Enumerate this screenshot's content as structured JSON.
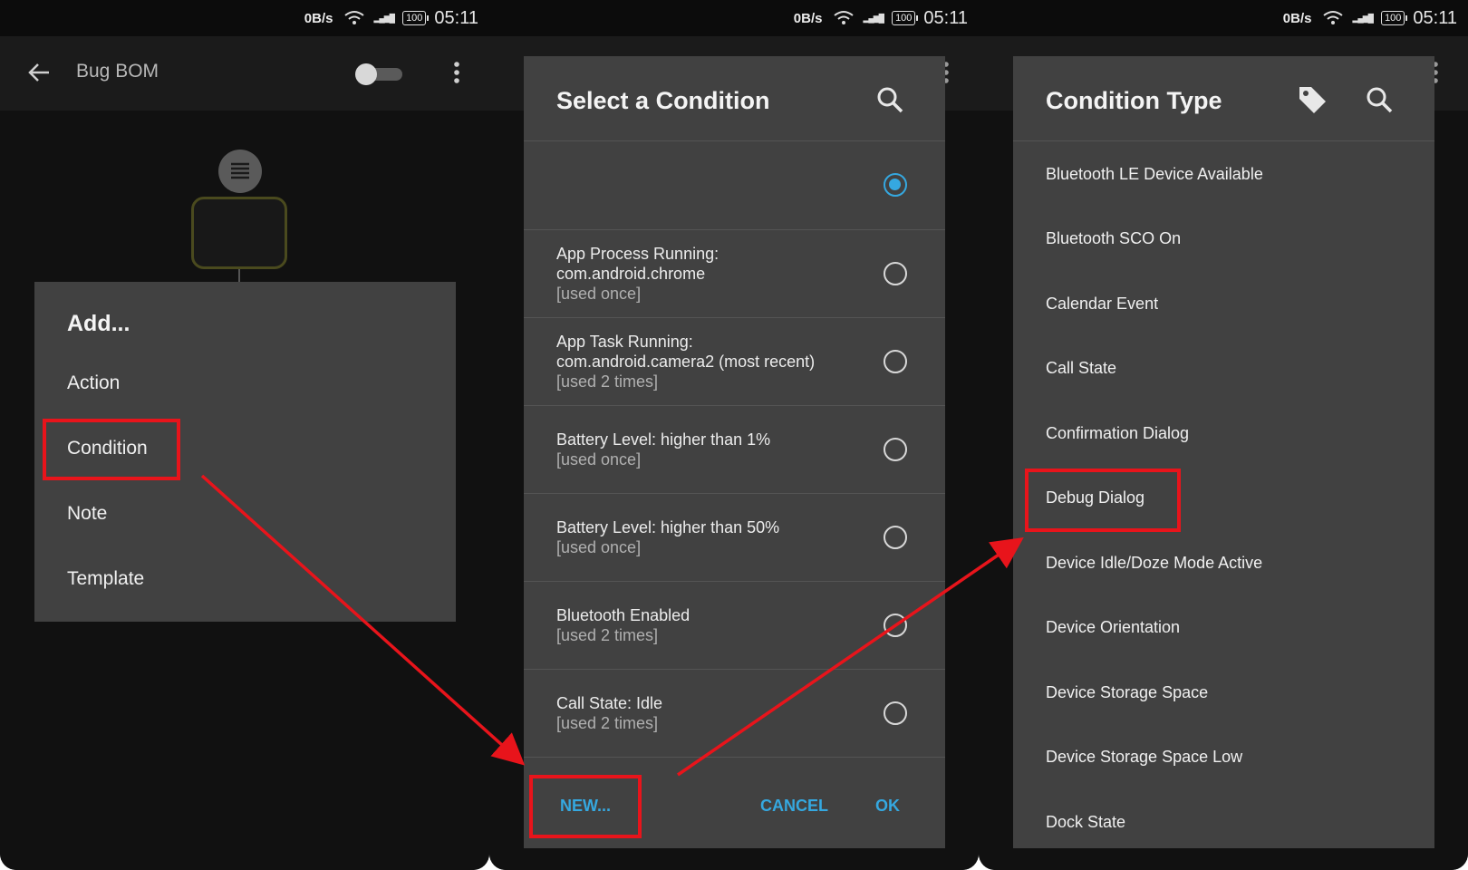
{
  "status_bar": {
    "speed": "0B/s",
    "signal": "4G 2G",
    "battery": "100",
    "time": "05:11"
  },
  "screen1": {
    "app_title": "Bug BOM",
    "add_menu": {
      "title": "Add...",
      "items": [
        "Action",
        "Condition",
        "Note",
        "Template"
      ]
    }
  },
  "screen2": {
    "dialog_title": "Select a Condition",
    "conditions": [
      {
        "title": "",
        "sub": "",
        "selected": true
      },
      {
        "title": "App Process Running:\ncom.android.chrome",
        "sub": "[used once]",
        "selected": false
      },
      {
        "title": "App Task Running:\ncom.android.camera2 (most recent)",
        "sub": "[used 2 times]",
        "selected": false
      },
      {
        "title": "Battery Level: higher than 1%",
        "sub": "[used once]",
        "selected": false
      },
      {
        "title": "Battery Level: higher than 50%",
        "sub": "[used once]",
        "selected": false
      },
      {
        "title": "Bluetooth Enabled",
        "sub": "[used 2 times]",
        "selected": false
      },
      {
        "title": "Call State: Idle",
        "sub": "[used 2 times]",
        "selected": false
      }
    ],
    "buttons": {
      "new": "NEW...",
      "cancel": "CANCEL",
      "ok": "OK"
    }
  },
  "screen3": {
    "dialog_title": "Condition Type",
    "types": [
      "Bluetooth LE Device Available",
      "Bluetooth SCO On",
      "Calendar Event",
      "Call State",
      "Confirmation Dialog",
      "Debug Dialog",
      "Device Idle/Doze Mode Active",
      "Device Orientation",
      "Device Storage Space",
      "Device Storage Space Low",
      "Dock State"
    ]
  },
  "colors": {
    "accent": "#35a8e0",
    "highlight": "#e8141b",
    "dialog_bg": "#414141",
    "node_border": "#4a4a1e"
  }
}
